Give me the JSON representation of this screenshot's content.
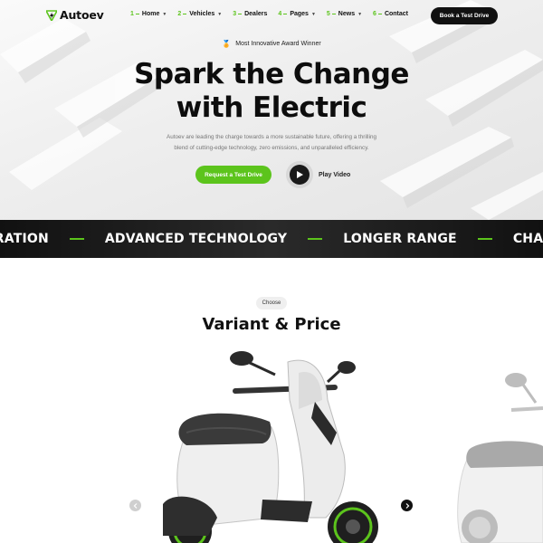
{
  "brand": {
    "name": "Autoev",
    "accent": "#5cc41c",
    "dark": "#111111"
  },
  "nav": {
    "items": [
      {
        "num": "1",
        "label": "Home",
        "dropdown": true
      },
      {
        "num": "2",
        "label": "Vehicles",
        "dropdown": true
      },
      {
        "num": "3",
        "label": "Dealers",
        "dropdown": false
      },
      {
        "num": "4",
        "label": "Pages",
        "dropdown": true
      },
      {
        "num": "5",
        "label": "News",
        "dropdown": true
      },
      {
        "num": "6",
        "label": "Contact",
        "dropdown": false
      }
    ],
    "cta": "Book a Test Drive"
  },
  "hero": {
    "award_icon": "award-medal-icon",
    "award": "Most Innovative Award Winner",
    "title_line1": "Spark the Change",
    "title_line2": "with Electric",
    "description_line1": "Autoev are leading the charge towards a more sustainable future, offering a thrilling",
    "description_line2": "blend of cutting-edge technology, zero emissions, and unparalleled efficiency.",
    "primary_cta": "Request a Test Drive",
    "video_cta": "Play Video"
  },
  "ticker": {
    "items": [
      "ERATION",
      "ADVANCED TECHNOLOGY",
      "LONGER RANGE",
      "CHARGING I"
    ]
  },
  "variant": {
    "eyebrow": "Choose",
    "title": "Variant & Price"
  }
}
